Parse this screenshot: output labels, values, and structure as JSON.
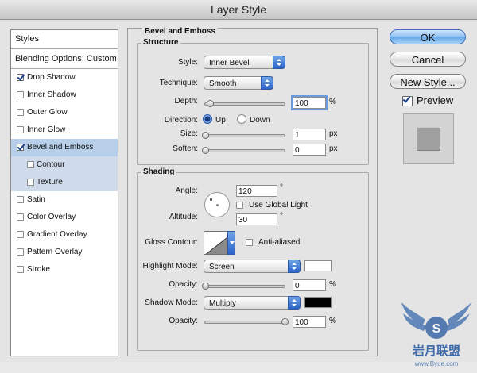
{
  "window": {
    "title": "Layer Style"
  },
  "left_panel": {
    "header": "Styles",
    "blending": "Blending Options: Custom",
    "items": [
      {
        "label": "Drop Shadow",
        "checked": true
      },
      {
        "label": "Inner Shadow",
        "checked": false
      },
      {
        "label": "Outer Glow",
        "checked": false
      },
      {
        "label": "Inner Glow",
        "checked": false
      },
      {
        "label": "Bevel and Emboss",
        "checked": true
      },
      {
        "label": "Contour",
        "checked": false
      },
      {
        "label": "Texture",
        "checked": false
      },
      {
        "label": "Satin",
        "checked": false
      },
      {
        "label": "Color Overlay",
        "checked": false
      },
      {
        "label": "Gradient Overlay",
        "checked": false
      },
      {
        "label": "Pattern Overlay",
        "checked": false
      },
      {
        "label": "Stroke",
        "checked": false
      }
    ]
  },
  "bevel": {
    "section_title": "Bevel and Emboss",
    "structure": {
      "title": "Structure",
      "style_label": "Style:",
      "style_value": "Inner Bevel",
      "technique_label": "Technique:",
      "technique_value": "Smooth",
      "depth_label": "Depth:",
      "depth_value": "100",
      "depth_unit": "%",
      "direction_label": "Direction:",
      "direction_up": "Up",
      "direction_down": "Down",
      "direction_selected": "Up",
      "size_label": "Size:",
      "size_value": "1",
      "size_unit": "px",
      "soften_label": "Soften:",
      "soften_value": "0",
      "soften_unit": "px"
    },
    "shading": {
      "title": "Shading",
      "angle_label": "Angle:",
      "angle_value": "120",
      "angle_unit": "°",
      "global_light_label": "Use Global Light",
      "global_light_checked": false,
      "altitude_label": "Altitude:",
      "altitude_value": "30",
      "altitude_unit": "°",
      "gloss_label": "Gloss Contour:",
      "antialias_label": "Anti-aliased",
      "antialias_checked": false,
      "highlight_mode_label": "Highlight Mode:",
      "highlight_mode_value": "Screen",
      "highlight_color": "#ffffff",
      "highlight_opacity_label": "Opacity:",
      "highlight_opacity_value": "0",
      "highlight_opacity_unit": "%",
      "shadow_mode_label": "Shadow Mode:",
      "shadow_mode_value": "Multiply",
      "shadow_color": "#000000",
      "shadow_opacity_label": "Opacity:",
      "shadow_opacity_value": "100",
      "shadow_opacity_unit": "%"
    }
  },
  "slider_levels": {
    "depth": 0.06,
    "size": 0.0,
    "soften": 0.0,
    "highlight_opacity": 0.0,
    "shadow_opacity": 1.0
  },
  "buttons": {
    "ok": "OK",
    "cancel": "Cancel",
    "new_style": "New Style...",
    "preview_label": "Preview",
    "preview_checked": true
  },
  "watermark": {
    "brand": "岩月联盟",
    "url": "www.Byue.com",
    "letter": "S"
  }
}
